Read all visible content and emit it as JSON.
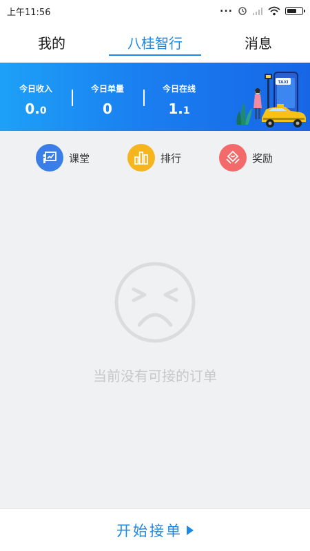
{
  "status_bar": {
    "time": "上午11:56",
    "dots": "...",
    "icons": [
      "alarm-icon",
      "signal-icon",
      "wifi-icon",
      "battery-icon"
    ]
  },
  "tabs": [
    {
      "label": "我的",
      "active": false
    },
    {
      "label": "八桂智行",
      "active": true
    },
    {
      "label": "消息",
      "active": false
    }
  ],
  "banner": {
    "stats": [
      {
        "label": "今日收入",
        "value_main": "0.",
        "value_small": "0"
      },
      {
        "label": "今日单量",
        "value_main": "0",
        "value_small": ""
      },
      {
        "label": "今日在线",
        "value_main": "1.",
        "value_small": "1"
      }
    ],
    "sign_text": "TAXI"
  },
  "quick_actions": [
    {
      "label": "课堂",
      "icon": "classroom-icon",
      "color": "#3a7fe8"
    },
    {
      "label": "排行",
      "icon": "ranking-icon",
      "color": "#f6b41d"
    },
    {
      "label": "奖励",
      "icon": "reward-icon",
      "color": "#f26a6a"
    }
  ],
  "empty_state": {
    "icon": "sad-face-icon",
    "message": "当前没有可接的订单"
  },
  "bottom": {
    "start_label": "开始接单"
  },
  "colors": {
    "accent": "#1e88e5",
    "banner_start": "#1da1f7",
    "banner_end": "#1766e6"
  }
}
